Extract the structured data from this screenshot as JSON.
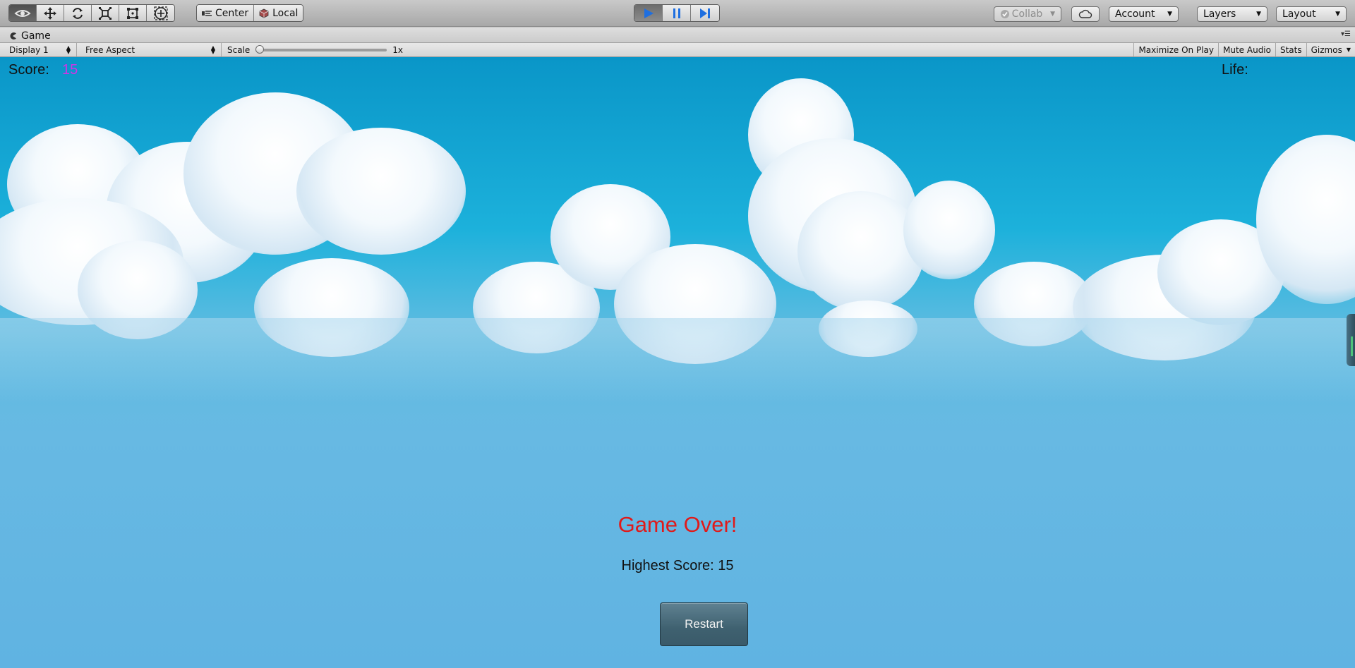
{
  "toolbar": {
    "tools": [
      "view-tool",
      "move-tool",
      "rotate-tool",
      "scale-tool",
      "rect-tool",
      "transform-tool"
    ],
    "pivot_label": "Center",
    "space_label": "Local",
    "collab_label": "Collab",
    "account_label": "Account",
    "layers_label": "Layers",
    "layout_label": "Layout"
  },
  "game_tab": {
    "title": "Game"
  },
  "game_bar": {
    "display_label": "Display 1",
    "aspect_label": "Free Aspect",
    "scale_label": "Scale",
    "scale_value": "1x",
    "maximize_label": "Maximize On Play",
    "mute_label": "Mute Audio",
    "stats_label": "Stats",
    "gizmos_label": "Gizmos"
  },
  "hud": {
    "score_label": "Score:",
    "score_value": "15",
    "life_label": "Life:"
  },
  "game_over": {
    "title": "Game Over!",
    "highest_score": "Highest Score: 15",
    "restart_label": "Restart"
  },
  "colors": {
    "score_value": "#d432e6",
    "game_over_text": "#e01a1a",
    "play_icon": "#1f6fe0"
  }
}
